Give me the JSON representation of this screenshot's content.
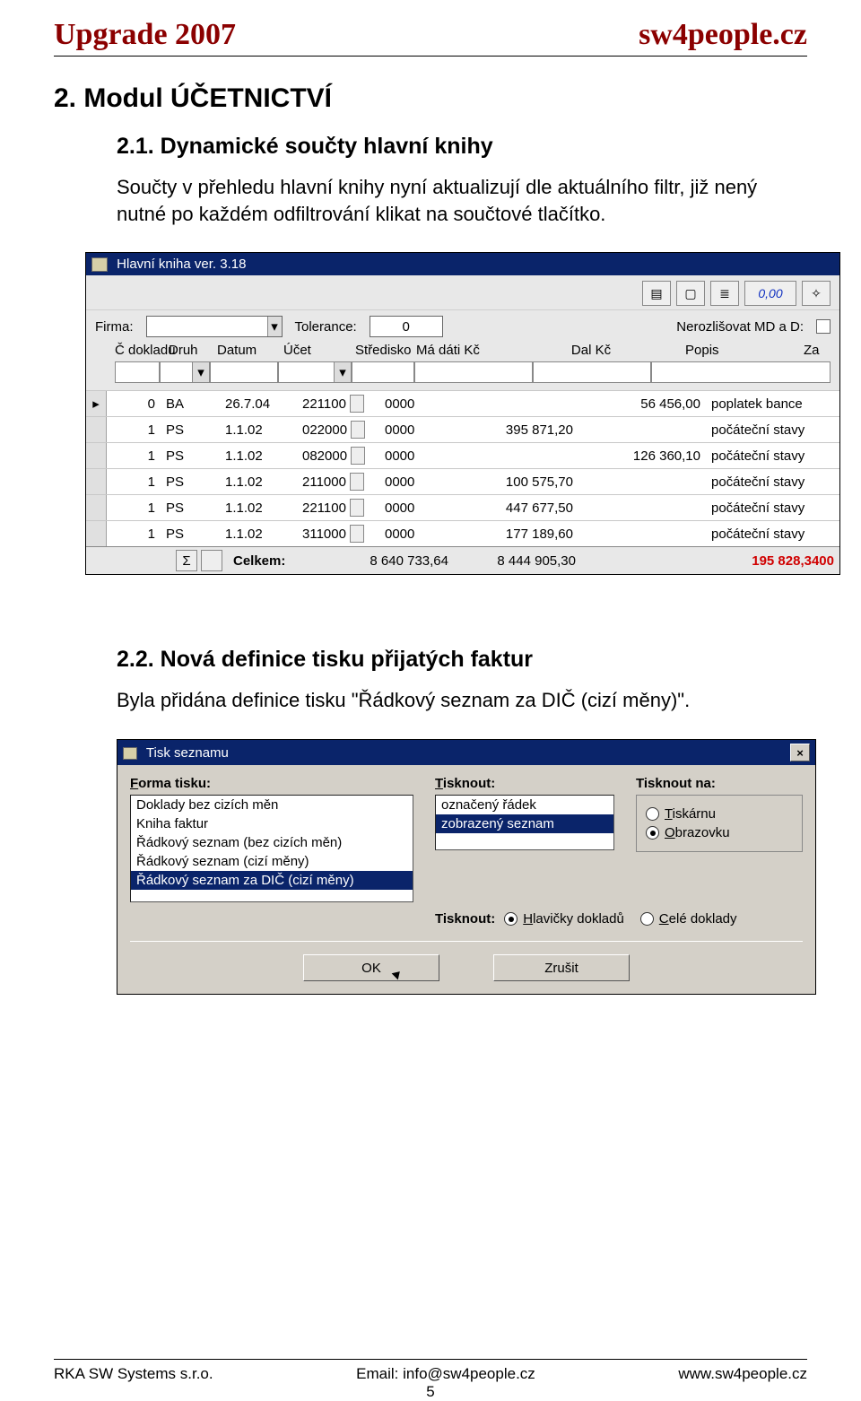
{
  "header": {
    "left": "Upgrade 2007",
    "right": "sw4people.cz"
  },
  "sec2": {
    "title": "2. Modul ÚČETNICTVÍ",
    "s21_title": "2.1. Dynamické součty hlavní knihy",
    "s21_body": "Součty v přehledu hlavní knihy nyní aktualizují dle aktuálního filtr, již nený nutné po každém odfiltrování klikat na součtové tlačítko.",
    "s22_title": "2.2. Nová definice tisku přijatých faktur",
    "s22_body": "Byla přidána definice tisku \"Řádkový seznam za DIČ (cizí měny)\"."
  },
  "ss1": {
    "title": "Hlavní kniha ver. 3.18",
    "toolbar_zero": "0,00",
    "firma_lbl": "Firma:",
    "tol_lbl": "Tolerance:",
    "tol_val": "0",
    "neroz_lbl": "Nerozlišovat MD a D:",
    "cols": {
      "c": "Č dokladu",
      "druh": "Druh",
      "datum": "Datum",
      "ucet": "Účet",
      "str": "Středisko",
      "md": "Má dáti Kč",
      "dal": "Dal Kč",
      "popis": "Popis",
      "za": "Za"
    },
    "rows": [
      {
        "c": "0",
        "druh": "BA",
        "datum": "26.7.04",
        "ucet": "221100",
        "str": "0000",
        "md": "",
        "dal": "56 456,00",
        "popis": "poplatek bance"
      },
      {
        "c": "1",
        "druh": "PS",
        "datum": "1.1.02",
        "ucet": "022000",
        "str": "0000",
        "md": "395 871,20",
        "dal": "",
        "popis": "počáteční stavy"
      },
      {
        "c": "1",
        "druh": "PS",
        "datum": "1.1.02",
        "ucet": "082000",
        "str": "0000",
        "md": "",
        "dal": "126 360,10",
        "popis": "počáteční stavy"
      },
      {
        "c": "1",
        "druh": "PS",
        "datum": "1.1.02",
        "ucet": "211000",
        "str": "0000",
        "md": "100 575,70",
        "dal": "",
        "popis": "počáteční stavy"
      },
      {
        "c": "1",
        "druh": "PS",
        "datum": "1.1.02",
        "ucet": "221100",
        "str": "0000",
        "md": "447 677,50",
        "dal": "",
        "popis": "počáteční stavy"
      },
      {
        "c": "1",
        "druh": "PS",
        "datum": "1.1.02",
        "ucet": "311000",
        "str": "0000",
        "md": "177 189,60",
        "dal": "",
        "popis": "počáteční stavy"
      }
    ],
    "totals": {
      "label": "Celkem:",
      "md": "8 640 733,64",
      "dal": "8 444 905,30",
      "diff": "195 828,3400"
    },
    "sigma": "Σ"
  },
  "ss2": {
    "title": "Tisk seznamu",
    "forma_lbl": "Forma tisku:",
    "forma_u": "F",
    "forma_items": [
      {
        "t": "Doklady bez cizích měn",
        "sel": false
      },
      {
        "t": "Kniha faktur",
        "sel": false
      },
      {
        "t": "Řádkový seznam (bez cizích měn)",
        "sel": false
      },
      {
        "t": "Řádkový seznam (cizí měny)",
        "sel": false
      },
      {
        "t": "Řádkový seznam za DIČ (cizí měny)",
        "sel": true
      }
    ],
    "tisk_lbl": "Tisknout:",
    "tisk_u": "T",
    "tisk_items": [
      {
        "t": "označený řádek",
        "sel": false
      },
      {
        "t": "zobrazený seznam",
        "sel": true
      }
    ],
    "na_lbl": "Tisknout na:",
    "na_opts": [
      {
        "t": "Tiskárnu",
        "u": "T",
        "checked": false
      },
      {
        "t": "Obrazovku",
        "u": "O",
        "checked": true
      }
    ],
    "row2_lbl": "Tisknout:",
    "row2_opts": [
      {
        "t": "Hlavičky dokladů",
        "u": "H",
        "checked": true
      },
      {
        "t": "Celé doklady",
        "u": "C",
        "checked": false
      }
    ],
    "ok": "OK",
    "cancel": "Zrušit"
  },
  "footer": {
    "left": "RKA SW Systems s.r.o.",
    "mid": "Email: info@sw4people.cz",
    "right": "www.sw4people.cz",
    "page": "5"
  }
}
